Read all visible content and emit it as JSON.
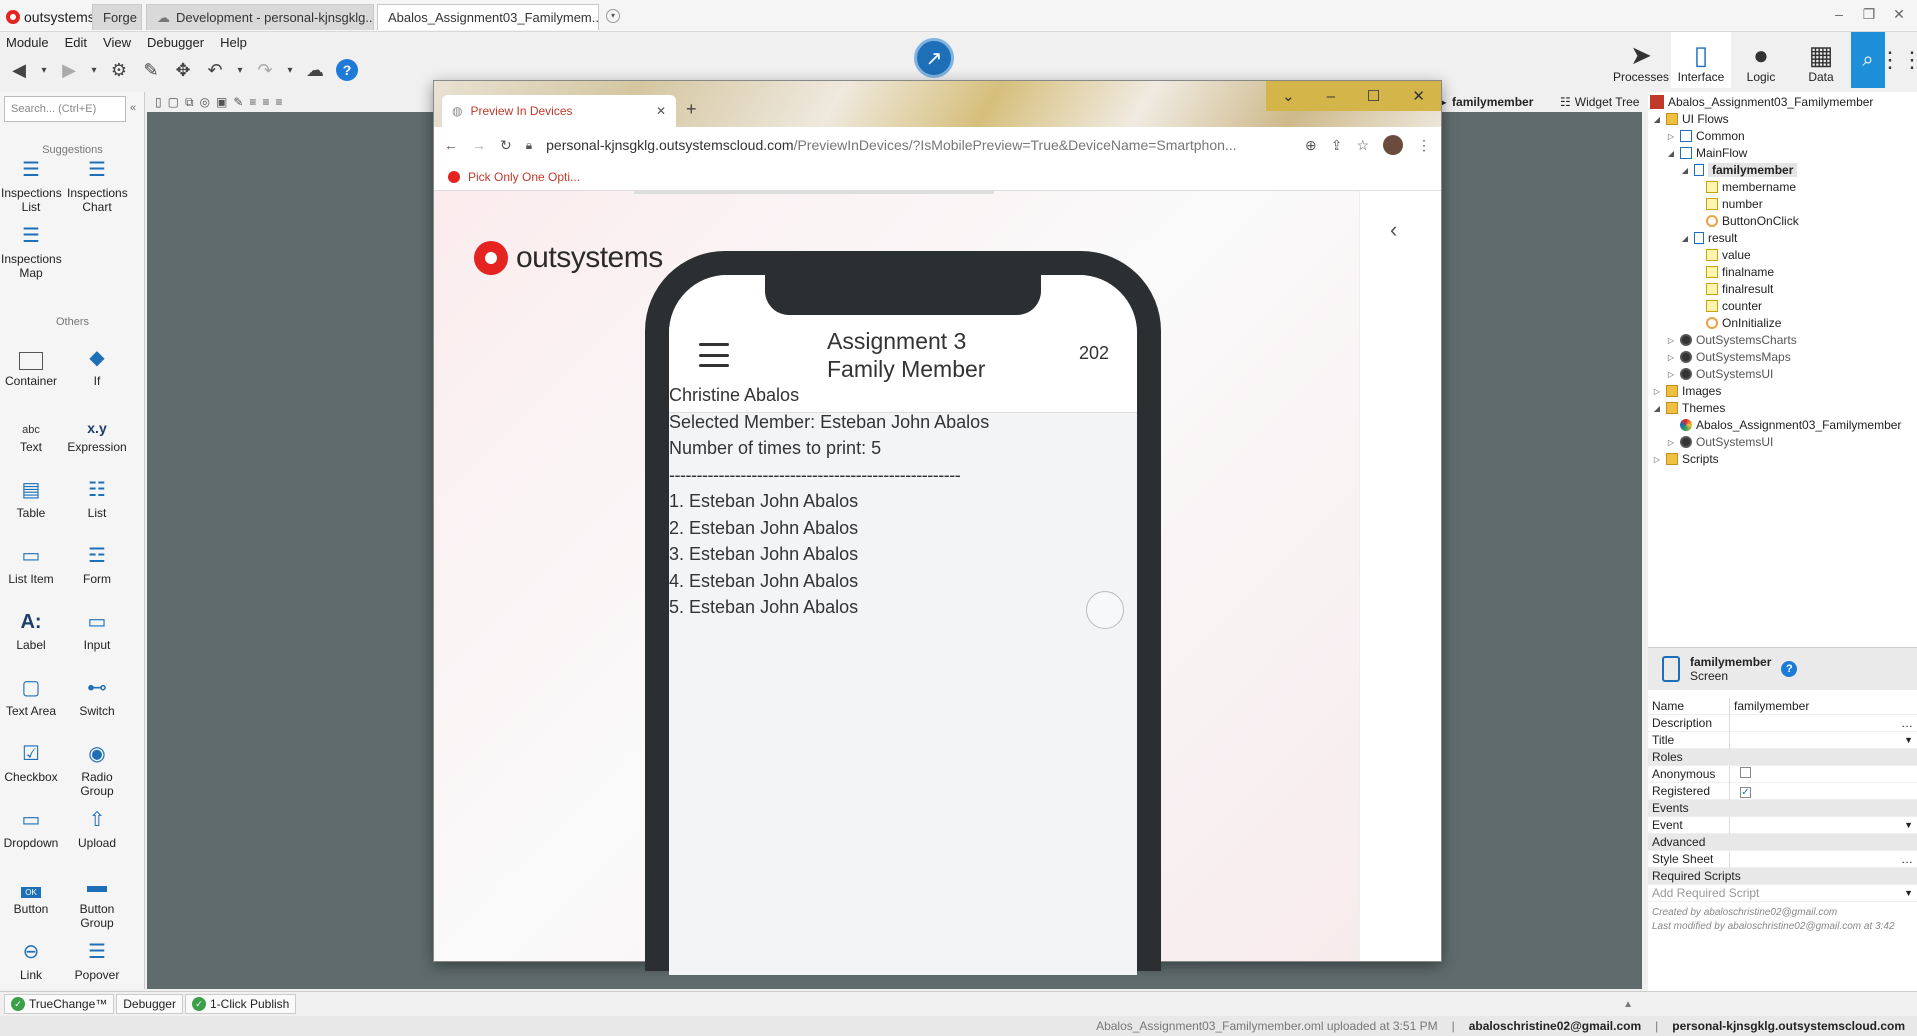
{
  "titlebar": {
    "logo": "outsystems",
    "tabs": [
      "Forge",
      "Development - personal-kjnsgklg....",
      "Abalos_Assignment03_Familymem..."
    ],
    "close": "×"
  },
  "menu": [
    "Module",
    "Edit",
    "View",
    "Debugger",
    "Help"
  ],
  "help_label": "?",
  "right_tabs": [
    {
      "label": "Processes",
      "icon": "processes-icon"
    },
    {
      "label": "Interface",
      "icon": "interface-icon"
    },
    {
      "label": "Logic",
      "icon": "logic-icon"
    },
    {
      "label": "Data",
      "icon": "data-icon"
    }
  ],
  "toolbox": {
    "search_placeholder": "Search... (Ctrl+E)",
    "suggestions_label": "Suggestions",
    "suggestions": [
      "Inspections List",
      "Inspections Chart",
      "Inspections Map"
    ],
    "others_label": "Others",
    "widgets": [
      "Container",
      "If",
      "Text",
      "Expression",
      "Table",
      "List",
      "List Item",
      "Form",
      "Label",
      "Input",
      "Text Area",
      "Switch",
      "Checkbox",
      "Radio Group",
      "Dropdown",
      "Upload",
      "Button",
      "Button Group",
      "Link",
      "Popover"
    ],
    "text_icon": "abc",
    "expr_icon": "x.y",
    "label_icon": "A:"
  },
  "canvas": {
    "breadcrumb": "familymember",
    "widget_tree": "Widget Tree"
  },
  "browser": {
    "tab_title": "Preview In Devices",
    "url_main": "personal-kjnsgklg.outsystemscloud.com",
    "url_rest": "/PreviewInDevices/?IsMobilePreview=True&DeviceName=Smartphon...",
    "bookmark": "Pick Only One Opti...",
    "logo_text": "outsystems"
  },
  "app": {
    "title_line1": "Assignment 3",
    "title_line2": "Family Member",
    "header_number": "202",
    "lines": [
      "Christine Abalos",
      "Selected Member: Esteban John Abalos",
      "Number of times to print: 5",
      "-----------------------------------------------------",
      "1. Esteban John Abalos",
      "2. Esteban John Abalos",
      "3. Esteban John Abalos",
      "4. Esteban John Abalos",
      "5. Esteban John Abalos"
    ]
  },
  "tree": {
    "app": "Abalos_Assignment03_Familymember",
    "ui_flows": "UI Flows",
    "common": "Common",
    "mainflow": "MainFlow",
    "familymember": "familymember",
    "membername": "membername",
    "number": "number",
    "buttononclick": "ButtonOnClick",
    "result": "result",
    "value": "value",
    "finalname": "finalname",
    "finalresult": "finalresult",
    "counter": "counter",
    "oninitialize": "OnInitialize",
    "charts": "OutSystemsCharts",
    "maps": "OutSystemsMaps",
    "ui": "OutSystemsUI",
    "images": "Images",
    "themes": "Themes",
    "theme_app": "Abalos_Assignment03_Familymember",
    "theme_ui": "OutSystemsUI",
    "scripts": "Scripts"
  },
  "props": {
    "header_name": "familymember",
    "header_type": "Screen",
    "name_k": "Name",
    "name_v": "familymember",
    "desc_k": "Description",
    "title_k": "Title",
    "roles": "Roles",
    "anon": "Anonymous",
    "anon_checked": false,
    "reg": "Registered",
    "reg_checked": true,
    "events": "Events",
    "event_k": "Event",
    "advanced": "Advanced",
    "style_k": "Style Sheet",
    "req_scripts": "Required Scripts",
    "add_script": "Add Required Script",
    "created": "Created by abaloschristine02@gmail.com",
    "modified": "Last modified by abaloschristine02@gmail.com at 3:42"
  },
  "bottom": {
    "truechange": "TrueChange™",
    "debugger": "Debugger",
    "publish": "1-Click Publish"
  },
  "status": {
    "upload": "Abalos_Assignment03_Familymember.oml uploaded at 3:51 PM",
    "user": "abaloschristine02@gmail.com",
    "server": "personal-kjnsgklg.outsystemscloud.com"
  }
}
